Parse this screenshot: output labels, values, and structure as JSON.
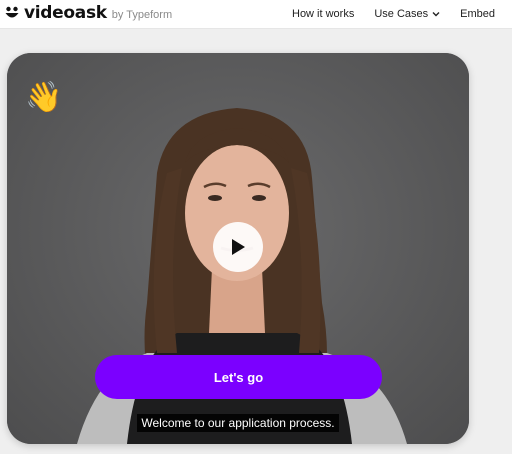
{
  "header": {
    "brand": "videoask",
    "brand_sub": "by Typeform",
    "nav": [
      {
        "label": "How it works"
      },
      {
        "label": "Use Cases"
      },
      {
        "label": "Embed"
      }
    ]
  },
  "video": {
    "emoji": "👋",
    "cta_label": "Let's go",
    "caption": "Welcome to our application process.",
    "accent_color": "#7b00ff"
  }
}
